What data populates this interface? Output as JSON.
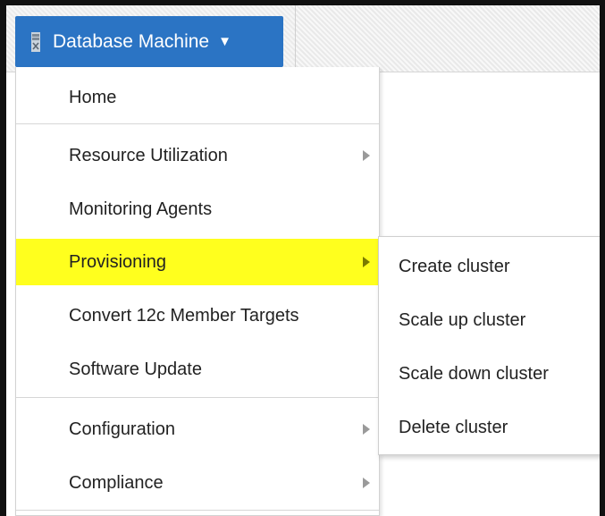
{
  "header": {
    "button_label": "Database Machine",
    "button_icon": "server-icon",
    "dropdown_icon": "caret-down-icon",
    "accent_color": "#2b74c4"
  },
  "menu": {
    "items": [
      {
        "label": "Home",
        "has_submenu": false
      },
      {
        "label": "Resource Utilization",
        "has_submenu": true
      },
      {
        "label": "Monitoring Agents",
        "has_submenu": false
      },
      {
        "label": "Provisioning",
        "has_submenu": true,
        "highlighted": true
      },
      {
        "label": "Convert 12c Member Targets",
        "has_submenu": false
      },
      {
        "label": "Software Update",
        "has_submenu": false
      },
      {
        "label": "Configuration",
        "has_submenu": true
      },
      {
        "label": "Compliance",
        "has_submenu": true
      }
    ],
    "highlight_color": "#ffff1e"
  },
  "submenu": {
    "items": [
      {
        "label": "Create cluster"
      },
      {
        "label": "Scale up cluster"
      },
      {
        "label": "Scale down cluster"
      },
      {
        "label": "Delete cluster"
      }
    ]
  }
}
